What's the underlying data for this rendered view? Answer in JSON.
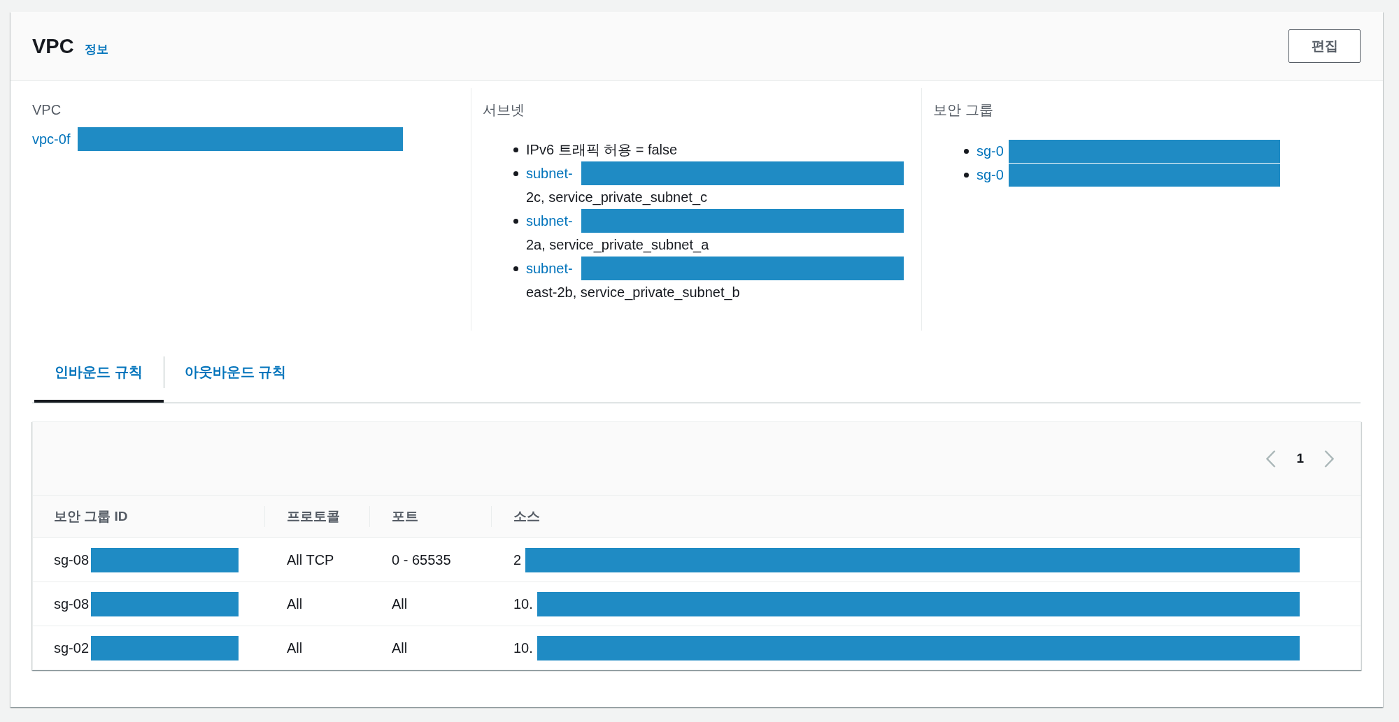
{
  "panel": {
    "title": "VPC",
    "info_link": "정보",
    "edit_button": "편집"
  },
  "details": {
    "vpc": {
      "label": "VPC",
      "value": "vpc-0f",
      "redacted": true
    },
    "subnets": {
      "label": "서브넷",
      "items": [
        {
          "kind": "text",
          "text": "IPv6 트래픽 허용 = false",
          "redacted": false
        },
        {
          "kind": "link",
          "text": "subnet-",
          "redacted": true,
          "detail": "2c, service_private_subnet_c"
        },
        {
          "kind": "link",
          "text": "subnet-",
          "redacted": true,
          "detail": "2a, service_private_subnet_a"
        },
        {
          "kind": "link",
          "text": "subnet-",
          "redacted": true,
          "detail": "east-2b, service_private_subnet_b"
        }
      ]
    },
    "security_groups": {
      "label": "보안 그룹",
      "items": [
        {
          "text": "sg-0",
          "redacted": true
        },
        {
          "text": "sg-0",
          "redacted": true
        }
      ]
    }
  },
  "tabs": [
    {
      "label": "인바운드 규칙",
      "selected": true
    },
    {
      "label": "아웃바운드 규칙",
      "selected": false
    }
  ],
  "pagination": {
    "current_page": "1",
    "previous_disabled": true,
    "next_disabled": true
  },
  "table": {
    "columns": [
      "보안 그룹 ID",
      "프로토콜",
      "포트",
      "소스"
    ],
    "rows": [
      {
        "cells": [
          {
            "text": "sg-08",
            "redacted": true
          },
          {
            "text": "All TCP",
            "redacted": false
          },
          {
            "text": "0 - 65535",
            "redacted": false
          },
          {
            "text": "2",
            "redacted": true
          }
        ]
      },
      {
        "cells": [
          {
            "text": "sg-08",
            "redacted": true
          },
          {
            "text": "All",
            "redacted": false
          },
          {
            "text": "All",
            "redacted": false
          },
          {
            "text": "10.",
            "redacted": true
          }
        ]
      },
      {
        "cells": [
          {
            "text": "sg-02",
            "redacted": true
          },
          {
            "text": "All",
            "redacted": false
          },
          {
            "text": "All",
            "redacted": false
          },
          {
            "text": "10.",
            "redacted": true
          }
        ]
      }
    ]
  }
}
